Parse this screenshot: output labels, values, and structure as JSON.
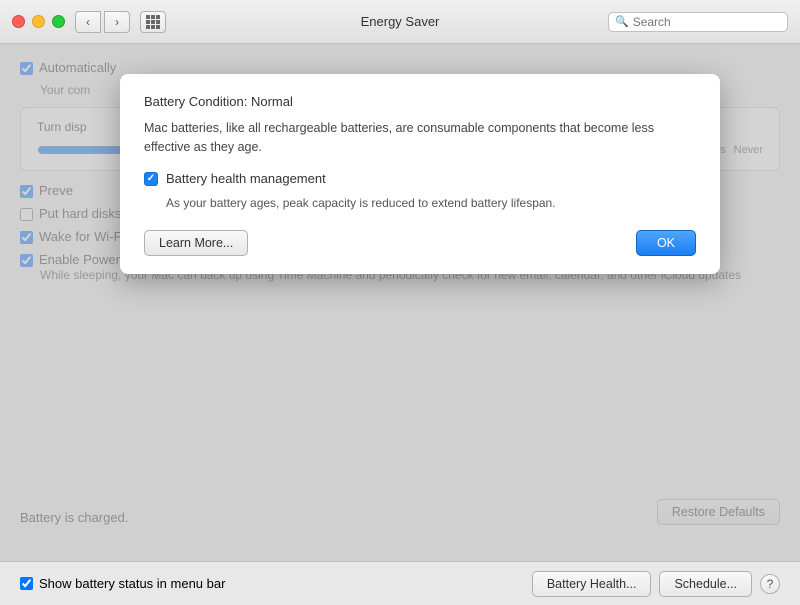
{
  "titleBar": {
    "title": "Energy Saver",
    "searchPlaceholder": "Search"
  },
  "popup": {
    "conditionLabel": "Battery Condition:",
    "conditionValue": "Normal",
    "description": "Mac batteries, like all rechargeable batteries, are consumable components that become less effective as they age.",
    "checkboxLabel": "Battery health management",
    "checkboxChecked": true,
    "checkboxDescription": "As your battery ages, peak capacity is reduced to extend battery lifespan.",
    "learnMoreLabel": "Learn More...",
    "okLabel": "OK"
  },
  "background": {
    "automaticLabel": "Automatically",
    "yourComputerLabel": "Your com",
    "turnDisplayLabel": "Turn disp",
    "preventLabel": "Preve",
    "hardDisksLabel": "Put hard disks to sleep when possible",
    "wifiLabel": "Wake for Wi-Fi network access",
    "powerNapLabel": "Enable Power Nap while plugged into a power adapter",
    "powerNapDesc": "While sleeping, your Mac can back up using Time Machine and periodically check for new email, calendar, and other iCloud updates",
    "batteryCharged": "Battery is charged.",
    "restoreDefaults": "Restore Defaults",
    "showBatteryLabel": "Show battery status in menu bar",
    "batteryHealthLabel": "Battery Health...",
    "scheduleLabel": "Schedule...",
    "hrsLabel": "hrs",
    "neverLabel": "Never"
  }
}
